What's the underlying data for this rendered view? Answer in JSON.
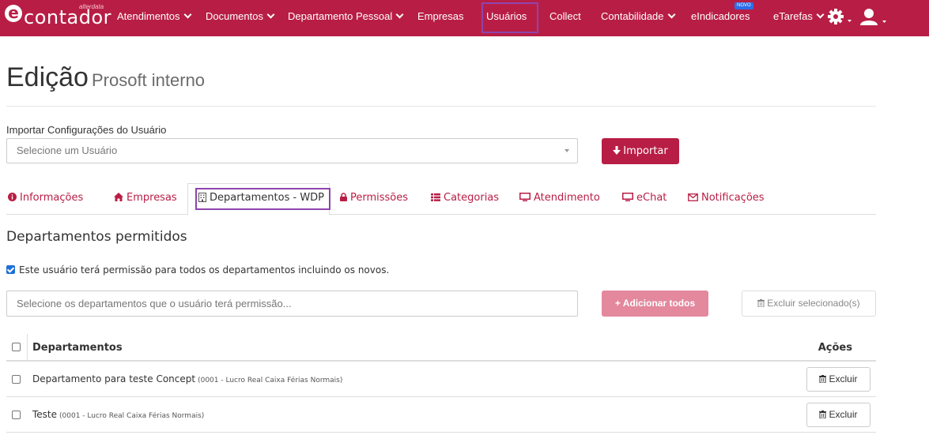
{
  "navbar": {
    "logo_word": "contador",
    "logo_small": "alterdata",
    "items": [
      {
        "label": "Atendimentos",
        "dropdown": true
      },
      {
        "label": "Documentos",
        "dropdown": true
      },
      {
        "label": "Departamento Pessoal",
        "dropdown": true
      },
      {
        "label": "Empresas",
        "dropdown": false
      },
      {
        "label": "Usuários",
        "dropdown": false
      },
      {
        "label": "Collect",
        "dropdown": false
      },
      {
        "label": "Contabilidade",
        "dropdown": true
      },
      {
        "label": "eIndicadores",
        "dropdown": false
      },
      {
        "label": "eTarefas",
        "dropdown": true
      }
    ],
    "badge": "NOVO",
    "brand_color": "#b81e45",
    "highlight_color": "#8e44ad"
  },
  "page": {
    "title": "Edição",
    "subtitle": "Prosoft interno"
  },
  "import": {
    "label": "Importar Configurações do Usuário",
    "select_placeholder": "Selecione um Usuário",
    "button": "Importar"
  },
  "tabs": [
    {
      "label": "Informações",
      "icon": "info-icon"
    },
    {
      "label": "Empresas",
      "icon": "home-icon"
    },
    {
      "label": "Departamentos - WDP",
      "icon": "building-icon",
      "active": true
    },
    {
      "label": "Permissões",
      "icon": "lock-icon"
    },
    {
      "label": "Categorias",
      "icon": "list-icon"
    },
    {
      "label": "Atendimento",
      "icon": "monitor-icon"
    },
    {
      "label": "eChat",
      "icon": "monitor-icon"
    },
    {
      "label": "Notificações",
      "icon": "envelope-icon"
    }
  ],
  "departments": {
    "section_title": "Departamentos permitidos",
    "all_permission_label": "Este usuário terá permissão para todos os departamentos incluindo os novos.",
    "all_permission_checked": true,
    "input_placeholder": "Selecione os departamentos que o usuário terá permissão...",
    "add_all_button": "Adicionar todos",
    "delete_selected_button": "Excluir selecionado(s)",
    "table": {
      "col_departments": "Departamentos",
      "col_actions": "Ações",
      "rows": [
        {
          "name": "Departamento para teste Concept",
          "detail": "(0001 - Lucro Real Caixa Férias Normais)",
          "action": "Excluir"
        },
        {
          "name": "Teste",
          "detail": "(0001 - Lucro Real Caixa Férias Normais)",
          "action": "Excluir"
        }
      ]
    }
  }
}
